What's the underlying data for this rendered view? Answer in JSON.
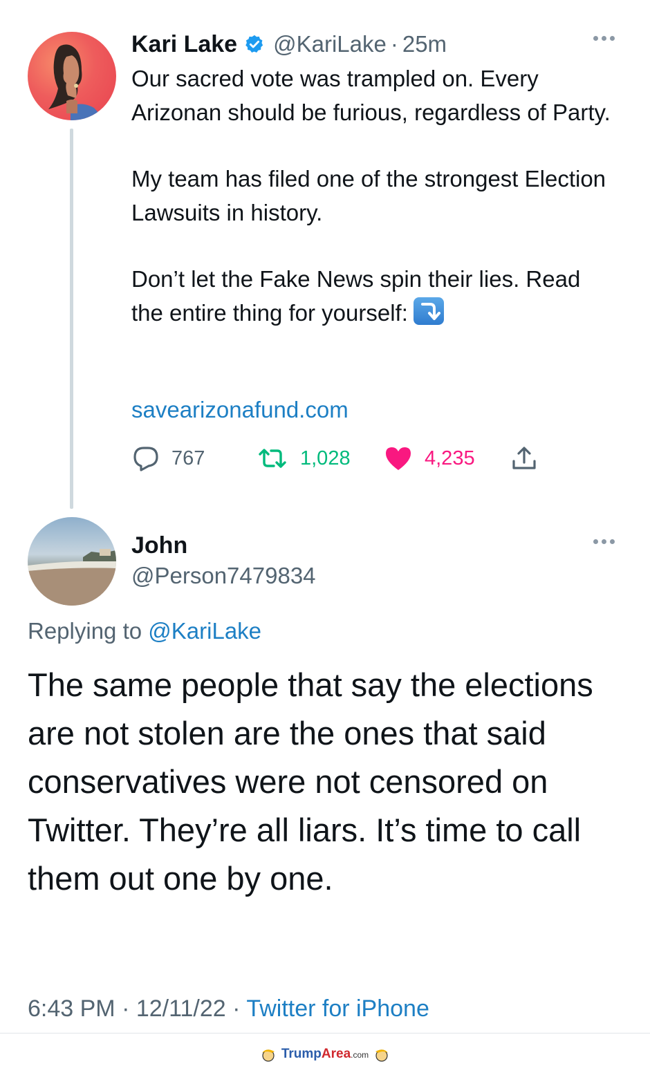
{
  "tweet": {
    "author_name": "Kari Lake",
    "handle": "@KariLake",
    "time_sep": "·",
    "time": "25m",
    "paragraphs": [
      "Our sacred vote was trampled on. Every Arizonan should be furious, regardless of Party.",
      "My team has filed one of the strongest Election Lawsuits in history.",
      "Don’t let the Fake News spin their lies. Read the entire thing for yourself:"
    ],
    "link": "savearizonafund.com",
    "stats": {
      "replies": "767",
      "retweets": "1,028",
      "likes": "4,235"
    },
    "icons": [
      "verified-badge-icon",
      "more-icon",
      "reply-icon",
      "retweet-icon",
      "heart-icon",
      "share-icon",
      "arrow-down-right-emoji"
    ],
    "colors": {
      "link": "#1d7fc4",
      "retweet": "#00ba7c",
      "like": "#f91880",
      "muted": "#536471"
    }
  },
  "reply": {
    "author_name": "John",
    "handle": "@Person7479834",
    "replying_prefix": "Replying to",
    "replying_to": "@KariLake",
    "text": "The same people that say the elections are not stolen are the ones that said conservatives were not censored on Twitter.  They’re all liars.  It’s time to call them out one by one.",
    "time": "6:43 PM",
    "date": "12/11/22",
    "sep": "·",
    "source": "Twitter for iPhone"
  },
  "watermark": {
    "brand_a": "Trump",
    "brand_b": "Area",
    "brand_c": ".com"
  }
}
